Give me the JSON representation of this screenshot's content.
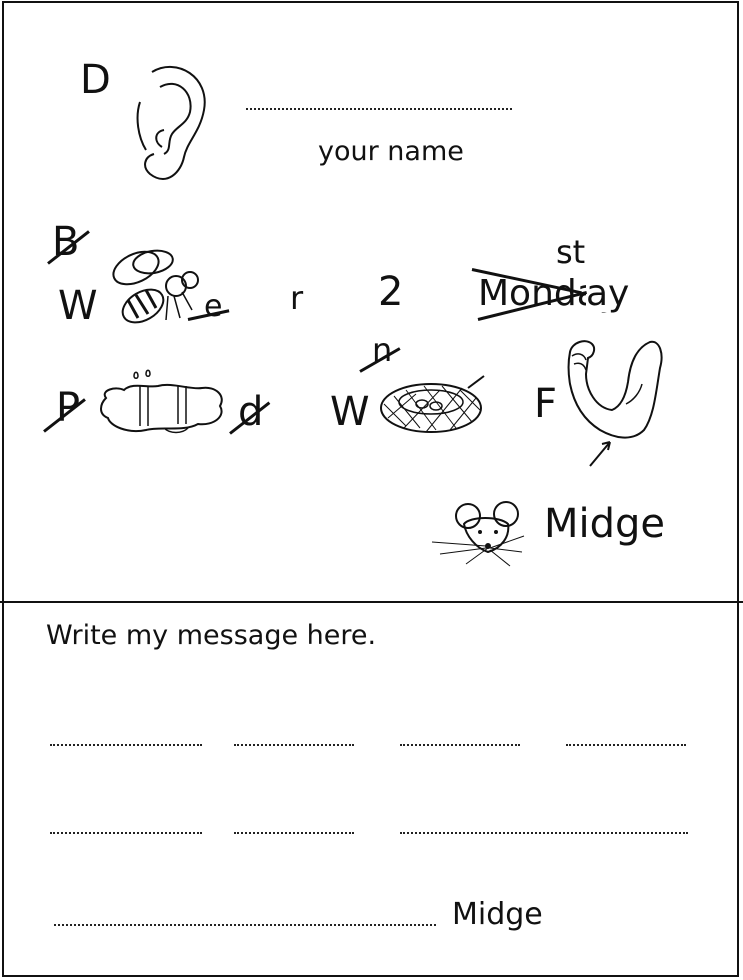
{
  "card": {
    "first_letter": "D",
    "your_name_label": "your name",
    "rebus": {
      "bee_crossed_letter": "B",
      "w_letter": "W",
      "bee_crossed_e": "e",
      "r_letter": "r",
      "two": "2",
      "monday_crossed": "Monday",
      "ay_suffix": "ay",
      "st_superscript": "st",
      "p_crossed": "P",
      "d_crossed": "d",
      "nest_w": "W",
      "nest_crossed_n": "n",
      "f_letter": "F"
    },
    "signature": "Midge"
  },
  "message": {
    "heading": "Write my message here.",
    "signature": "Midge"
  },
  "icons": [
    "ear-icon",
    "bee-icon",
    "puddle-icon",
    "nest-icon",
    "arm-muscle-icon",
    "mouse-icon"
  ]
}
